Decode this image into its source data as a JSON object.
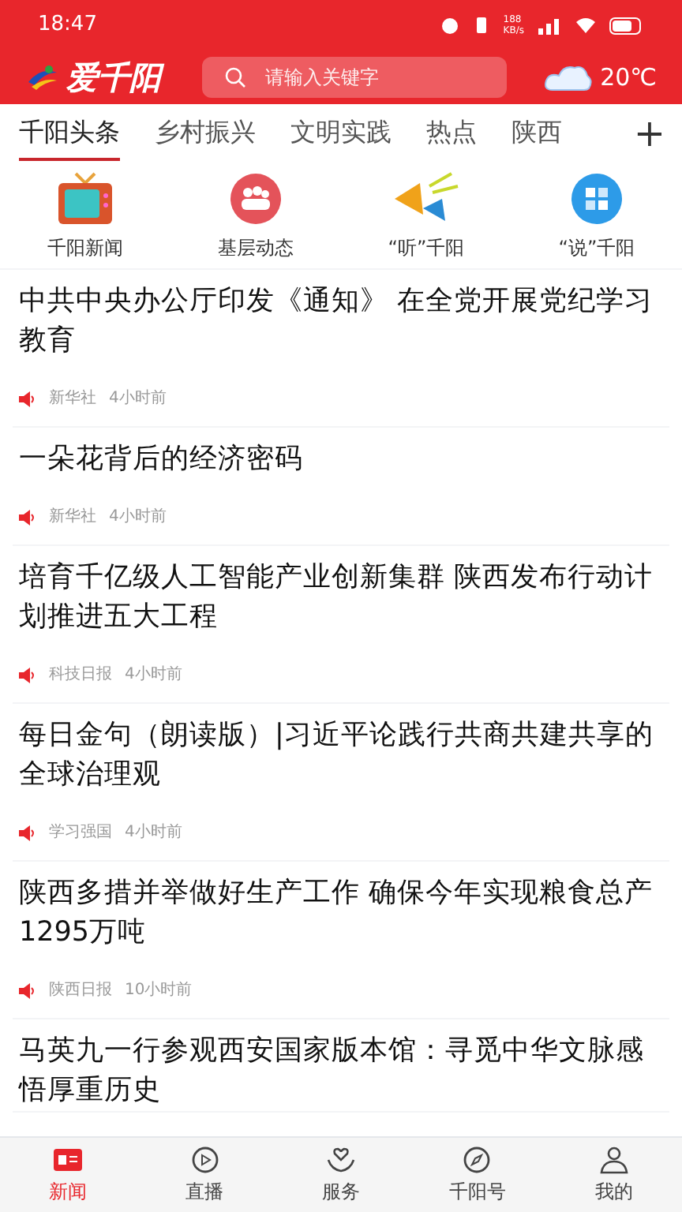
{
  "status_bar": {
    "time": "18:47",
    "speed": "188\nKB/s"
  },
  "header": {
    "logo": "爱千阳",
    "search": {
      "placeholder": "请输入关键字"
    },
    "weather": {
      "temperature": "20℃"
    }
  },
  "tabs": [
    {
      "label": "千阳头条",
      "selected": true
    },
    {
      "label": "乡村振兴",
      "selected": false
    },
    {
      "label": "文明实践",
      "selected": false
    },
    {
      "label": "热点",
      "selected": false
    },
    {
      "label": "陕西",
      "selected": false
    }
  ],
  "shortcuts": [
    {
      "label": "千阳新闻",
      "kind": "tv"
    },
    {
      "label": "基层动态",
      "kind": "people"
    },
    {
      "label": "“听”千阳",
      "kind": "megaphone"
    },
    {
      "label": "“说”千阳",
      "kind": "blocks"
    }
  ],
  "articles": [
    {
      "title": "中共中央办公厅印发《通知》 在全党开展党纪学习教育",
      "source": "新华社",
      "time": "4小时前"
    },
    {
      "title": "一朵花背后的经济密码",
      "source": "新华社",
      "time": "4小时前"
    },
    {
      "title": "培育千亿级人工智能产业创新集群 陕西发布行动计划推进五大工程",
      "source": "科技日报",
      "time": "4小时前"
    },
    {
      "title": "每日金句（朗读版）|习近平论践行共商共建共享的全球治理观",
      "source": "学习强国",
      "time": "4小时前"
    },
    {
      "title": "陕西多措并举做好生产工作 确保今年实现粮食总产1295万吨",
      "source": "陕西日报",
      "time": "10小时前"
    },
    {
      "title": "马英九一行参观西安国家版本馆：寻觅中华文脉感悟厚重历史"
    }
  ],
  "bottom_nav": [
    {
      "label": "新闻",
      "kind": "news",
      "selected": true
    },
    {
      "label": "直播",
      "kind": "play",
      "selected": false
    },
    {
      "label": "服务",
      "kind": "heart",
      "selected": false
    },
    {
      "label": "千阳号",
      "kind": "compass",
      "selected": false
    },
    {
      "label": "我的",
      "kind": "person",
      "selected": false
    }
  ]
}
